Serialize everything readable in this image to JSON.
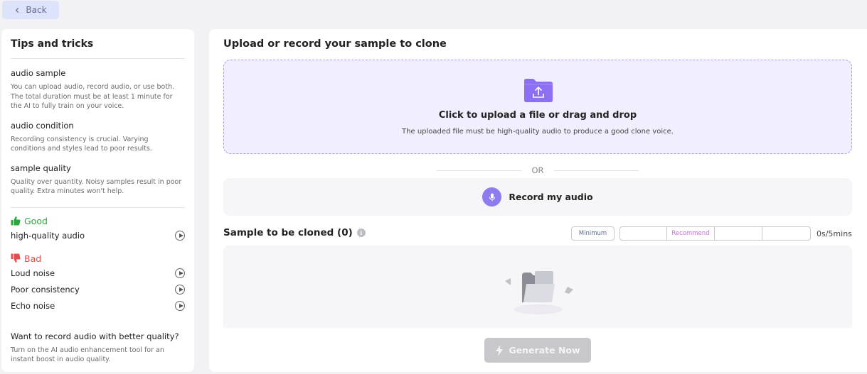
{
  "back_label": "Back",
  "tips": {
    "title": "Tips and tricks",
    "items": [
      {
        "title": "audio sample",
        "desc": "You can upload audio, record audio, or use both. The total duration must be at least 1 minute for the AI to fully train on your voice."
      },
      {
        "title": "audio condition",
        "desc": "Recording consistency is crucial. Varying conditions and styles lead to poor results."
      },
      {
        "title": "sample quality",
        "desc": "Quality over quantity. Noisy samples result in poor quality. Extra minutes won't help."
      }
    ],
    "good_label": "Good",
    "good_samples": [
      "high-quality audio"
    ],
    "bad_label": "Bad",
    "bad_samples": [
      "Loud noise",
      "Poor consistency",
      "Echo noise"
    ],
    "want_title": "Want to record audio with better quality?",
    "want_desc": "Turn on the AI audio enhancement tool for an instant boost in audio quality."
  },
  "main": {
    "title": "Upload or record your sample to clone",
    "upload_title": "Click to upload a file or drag and drop",
    "upload_desc": "The uploaded file must be high-quality audio to produce a good clone voice.",
    "or_label": "OR",
    "record_label": "Record my audio",
    "clone_title": "Sample to be cloned (0)",
    "minimum_label": "Minimum",
    "recommend_label": "Recommend",
    "duration_text": "0s/5mins",
    "recorded_fraction": 0,
    "generate_label": "Generate Now"
  },
  "colors": {
    "accent": "#8d7bf0",
    "good": "#2da63c",
    "bad": "#e54c4c",
    "recommend": "#c26fd8"
  }
}
